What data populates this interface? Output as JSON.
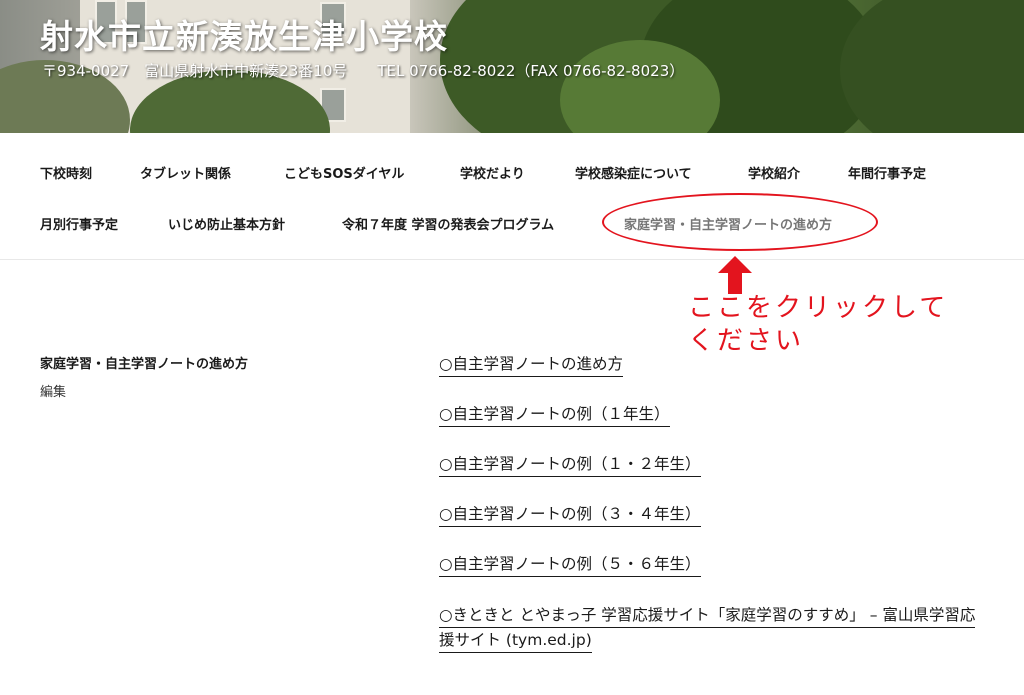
{
  "header": {
    "site_title": "射水市立新湊放生津小学校",
    "site_description": "〒934-0027　富山県射水市中新湊23番10号　　TEL 0766-82-8022（FAX 0766-82-8023）"
  },
  "nav": {
    "items": [
      {
        "label": "下校時刻"
      },
      {
        "label": "タブレット関係"
      },
      {
        "label": "こどもSOSダイヤル"
      },
      {
        "label": "学校だより"
      },
      {
        "label": "学校感染症について"
      },
      {
        "label": "学校紹介"
      },
      {
        "label": "年間行事予定"
      },
      {
        "label": "月別行事予定"
      },
      {
        "label": "いじめ防止基本方針"
      },
      {
        "label": "令和７年度 学習の発表会プログラム"
      },
      {
        "label": "家庭学習・自主学習ノートの進め方",
        "current": true
      }
    ]
  },
  "annotation": {
    "line1": "ここをクリックして",
    "line2": "ください",
    "color": "#e3141e"
  },
  "entry": {
    "title": "家庭学習・自主学習ノートの進め方",
    "edit_label": "編集"
  },
  "links": [
    {
      "text": "○自主学習ノートの進め方"
    },
    {
      "text": "○自主学習ノートの例（１年生）"
    },
    {
      "text": "○自主学習ノートの例（１・２年生）"
    },
    {
      "text": "○自主学習ノートの例（３・４年生）"
    },
    {
      "text": "○自主学習ノートの例（５・６年生）"
    },
    {
      "text": "○きときと とやまっ子 学習応援サイト「家庭学習のすすめ」 – 富山県学習応援サイト (tym.ed.jp)"
    }
  ]
}
